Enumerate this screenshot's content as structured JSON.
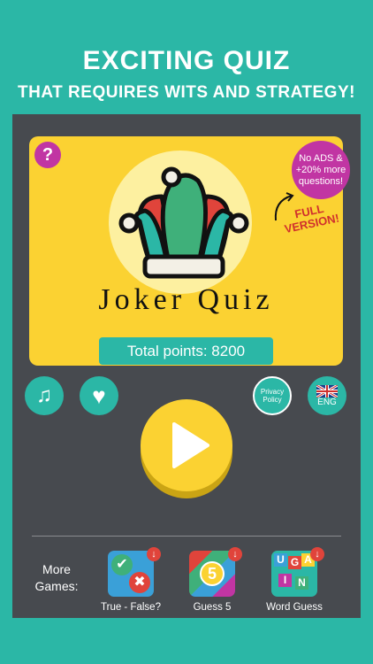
{
  "headline": {
    "line1": "EXCITING QUIZ",
    "line2": "THAT REQUIRES WITS AND STRATEGY!"
  },
  "app": {
    "title": "Joker Quiz",
    "help_label": "?",
    "total_points_label": "Total points: 8200",
    "promo": {
      "line1": "No ADS &",
      "line2": "+20% more",
      "line3": "questions!"
    },
    "full_version": {
      "line1": "FULL",
      "line2": "VERSION!"
    },
    "privacy_label_1": "Privacy",
    "privacy_label_2": "Policy",
    "language_label": "ENG",
    "more_games_label_1": "More",
    "more_games_label_2": "Games:",
    "games": [
      {
        "label": "True - False?"
      },
      {
        "label": "Guess 5"
      },
      {
        "label": "Word Guess"
      }
    ],
    "guess5_number": "5",
    "word_tile_letters": [
      "U",
      "G",
      "A",
      "I",
      "N"
    ],
    "colors": {
      "teal": "#2bb7a6",
      "yellow": "#fbd232",
      "magenta": "#c135a3",
      "dark": "#474a4f"
    }
  }
}
